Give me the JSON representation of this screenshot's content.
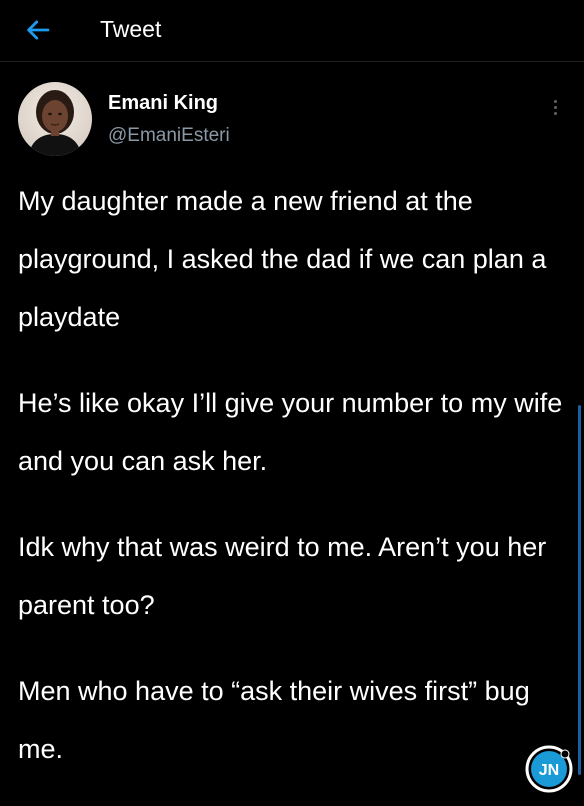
{
  "header": {
    "title": "Tweet",
    "back_icon": "arrow-left-icon",
    "accent_color": "#1d9bf0"
  },
  "author": {
    "name": "Emani King",
    "handle": "@EmaniEsteri",
    "avatar_icon": "user-avatar"
  },
  "tweet": {
    "paragraphs": [
      "My daughter made a new friend at the playground, I asked the dad if we can plan a playdate",
      "He’s like okay I’ll give your number to my wife and you can ask her.",
      "Idk why that was weird to me. Aren’t you her parent too?",
      "Men who have to “ask their wives first” bug me."
    ]
  },
  "watermark": {
    "text": "JN",
    "icon": "jn-logo-icon"
  }
}
